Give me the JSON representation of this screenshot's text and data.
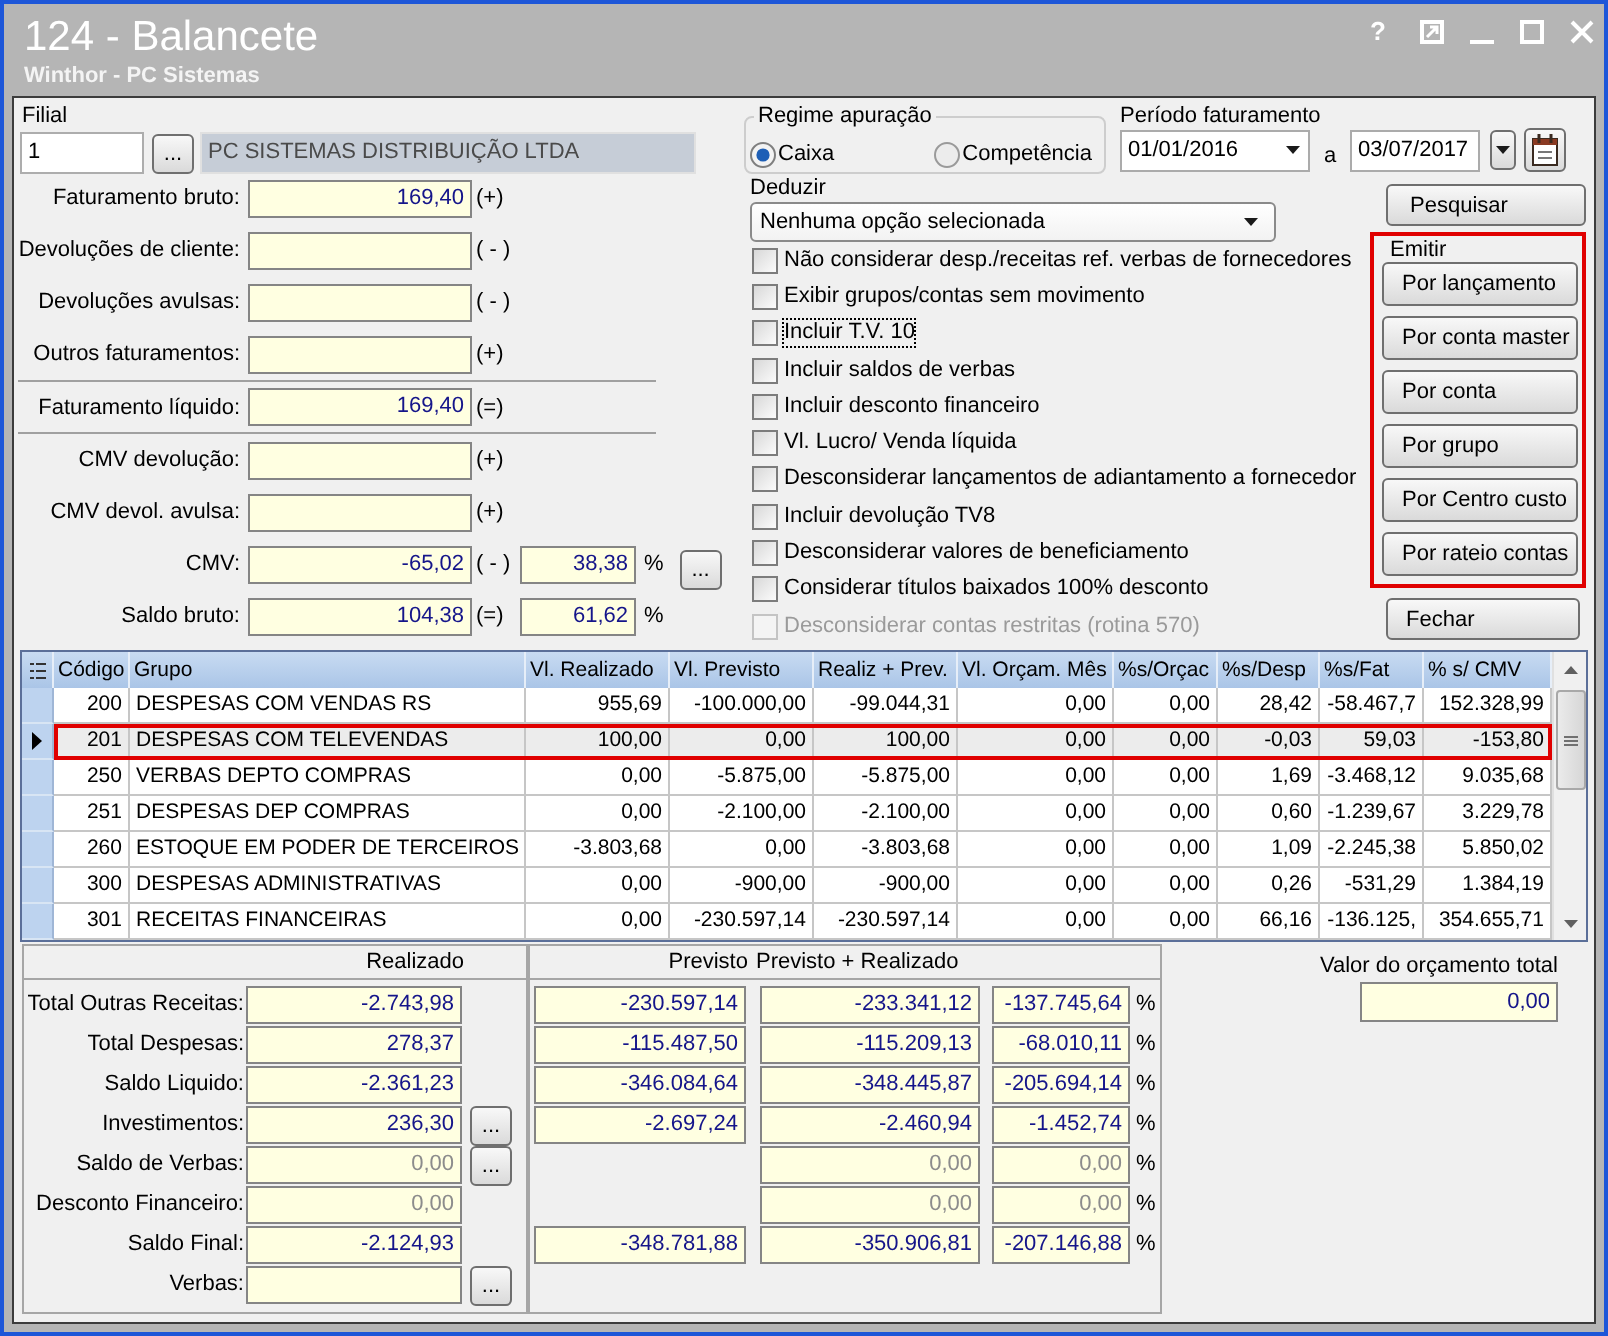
{
  "window": {
    "title": "124 - Balancete",
    "subtitle": "Winthor - PC Sistemas",
    "help": "?"
  },
  "filial": {
    "label": "Filial",
    "code": "1",
    "lookup": "...",
    "name": "PC SISTEMAS DISTRIBUIÇÃO LTDA"
  },
  "summary": [
    {
      "kind": "entry",
      "label": "Faturamento bruto:",
      "value": "169,40",
      "sign": "(+)"
    },
    {
      "kind": "entry",
      "label": "Devoluções de cliente:",
      "sign": "( - )"
    },
    {
      "kind": "entry",
      "label": "Devoluções avulsas:",
      "sign": "( - )"
    },
    {
      "kind": "entry",
      "label": "Outros faturamentos:",
      "sign": "(+)"
    },
    {
      "kind": "subtotal",
      "label": "Faturamento líquido:",
      "value": "169,40",
      "sign": "(=)"
    },
    {
      "kind": "entry",
      "label": "CMV devolução:",
      "sign": "(+)"
    },
    {
      "kind": "entry",
      "label": "CMV devol. avulsa:",
      "sign": "(+)"
    },
    {
      "kind": "entry",
      "label": "CMV:",
      "value": "-65,02",
      "sign": "( - )",
      "percent": "38,38",
      "percent_sign": "%",
      "button": "..."
    },
    {
      "kind": "entry",
      "label": "Saldo bruto:",
      "value": "104,38",
      "sign": "(=)",
      "percent": "61,62",
      "percent_sign": "%"
    }
  ],
  "regime": {
    "title": "Regime apuração",
    "options": [
      {
        "label": "Caixa",
        "selected": true
      },
      {
        "label": "Competência",
        "selected": false
      }
    ]
  },
  "period": {
    "label": "Período faturamento",
    "from": "01/01/2016",
    "separator": "a",
    "to": "03/07/2017"
  },
  "deduct": {
    "label": "Deduzir",
    "value": "Nenhuma opção selecionada"
  },
  "options": [
    {
      "label": "Não considerar desp./receitas ref. verbas de fornecedores",
      "checked": false,
      "disabled": false,
      "focused": false
    },
    {
      "label": "Exibir grupos/contas sem movimento",
      "checked": false,
      "disabled": false,
      "focused": false
    },
    {
      "label": "Incluir T.V. 10",
      "checked": false,
      "disabled": false,
      "focused": true
    },
    {
      "label": "Incluir saldos de verbas",
      "checked": false,
      "disabled": false,
      "focused": false
    },
    {
      "label": "Incluir desconto financeiro",
      "checked": false,
      "disabled": false,
      "focused": false
    },
    {
      "label": "Vl. Lucro/ Venda líquida",
      "checked": false,
      "disabled": false,
      "focused": false
    },
    {
      "label": "Desconsiderar lançamentos de adiantamento a fornecedor",
      "checked": false,
      "disabled": false,
      "focused": false
    },
    {
      "label": "Incluir devolução TV8",
      "checked": false,
      "disabled": false,
      "focused": false
    },
    {
      "label": "Desconsiderar valores de beneficiamento",
      "checked": false,
      "disabled": false,
      "focused": false
    },
    {
      "label": "Considerar títulos baixados 100% desconto",
      "checked": false,
      "disabled": false,
      "focused": false
    },
    {
      "label": "Desconsiderar contas restritas (rotina 570)",
      "checked": false,
      "disabled": true,
      "focused": false
    }
  ],
  "search_button": "Pesquisar",
  "emit": {
    "title": "Emitir",
    "highlighted": true,
    "buttons": [
      "Por lançamento",
      "Por conta master",
      "Por conta",
      "Por grupo",
      "Por Centro custo",
      "Por rateio contas"
    ]
  },
  "close_button": "Fechar",
  "table": {
    "columns": [
      "Código",
      "Grupo",
      "Vl. Realizado",
      "Vl. Previsto",
      "Realiz + Prev.",
      "Vl. Orçam. Mês",
      "%s/Orçac",
      "%s/Desp",
      "%s/Fat",
      "% s/ CMV"
    ],
    "rows": [
      {
        "cells": [
          "200",
          "DESPESAS COM VENDAS RS",
          "955,69",
          "-100.000,00",
          "-99.044,31",
          "0,00",
          "0,00",
          "28,42",
          "-58.467,7",
          "152.328,99"
        ],
        "selected": false,
        "highlighted": false
      },
      {
        "cells": [
          "201",
          "DESPESAS COM TELEVENDAS",
          "100,00",
          "0,00",
          "100,00",
          "0,00",
          "0,00",
          "-0,03",
          "59,03",
          "-153,80"
        ],
        "selected": true,
        "highlighted": true
      },
      {
        "cells": [
          "250",
          "VERBAS DEPTO COMPRAS",
          "0,00",
          "-5.875,00",
          "-5.875,00",
          "0,00",
          "0,00",
          "1,69",
          "-3.468,12",
          "9.035,68"
        ],
        "selected": false,
        "highlighted": false
      },
      {
        "cells": [
          "251",
          "DESPESAS DEP COMPRAS",
          "0,00",
          "-2.100,00",
          "-2.100,00",
          "0,00",
          "0,00",
          "0,60",
          "-1.239,67",
          "3.229,78"
        ],
        "selected": false,
        "highlighted": false
      },
      {
        "cells": [
          "260",
          "ESTOQUE EM PODER DE TERCEIROS",
          "-3.803,68",
          "0,00",
          "-3.803,68",
          "0,00",
          "0,00",
          "1,09",
          "-2.245,38",
          "5.850,02"
        ],
        "selected": false,
        "highlighted": false
      },
      {
        "cells": [
          "300",
          "DESPESAS ADMINISTRATIVAS",
          "0,00",
          "-900,00",
          "-900,00",
          "0,00",
          "0,00",
          "0,26",
          "-531,29",
          "1.384,19"
        ],
        "selected": false,
        "highlighted": false
      },
      {
        "cells": [
          "301",
          "RECEITAS FINANCEIRAS",
          "0,00",
          "-230.597,14",
          "-230.597,14",
          "0,00",
          "0,00",
          "66,16",
          "-136.125,",
          "354.655,71"
        ],
        "selected": false,
        "highlighted": false
      }
    ]
  },
  "totals": {
    "realizado_header": "Realizado",
    "previsto_header": "Previsto",
    "combined_header": "Previsto + Realizado",
    "rows": [
      {
        "label": "Total Outras Receitas:",
        "realizado": "-2.743,98",
        "previsto": "-230.597,14",
        "combined": "-233.341,12",
        "percent": "-137.745,64",
        "percent_sign": "%",
        "disabled": false
      },
      {
        "label": "Total Despesas:",
        "realizado": "278,37",
        "previsto": "-115.487,50",
        "combined": "-115.209,13",
        "percent": "-68.010,11",
        "percent_sign": "%",
        "disabled": false
      },
      {
        "label": "Saldo Liquido:",
        "realizado": "-2.361,23",
        "previsto": "-346.084,64",
        "combined": "-348.445,87",
        "percent": "-205.694,14",
        "percent_sign": "%",
        "disabled": false
      },
      {
        "label": "Investimentos:",
        "realizado": "236,30",
        "button": "...",
        "previsto": "-2.697,24",
        "combined": "-2.460,94",
        "percent": "-1.452,74",
        "percent_sign": "%",
        "disabled": false
      },
      {
        "label": "Saldo de Verbas:",
        "realizado": "0,00",
        "button": "...",
        "combined": "0,00",
        "percent": "0,00",
        "percent_sign": "%",
        "disabled": true
      },
      {
        "label": "Desconto Financeiro:",
        "realizado": "0,00",
        "combined": "0,00",
        "percent": "0,00",
        "percent_sign": "%",
        "disabled": true
      },
      {
        "label": "Saldo Final:",
        "realizado": "-2.124,93",
        "previsto": "-348.781,88",
        "combined": "-350.906,81",
        "percent": "-207.146,88",
        "percent_sign": "%",
        "disabled": false
      },
      {
        "label": "Verbas:",
        "button": "..."
      }
    ]
  },
  "budget": {
    "label": "Valor do orçamento total",
    "value": "0,00"
  }
}
